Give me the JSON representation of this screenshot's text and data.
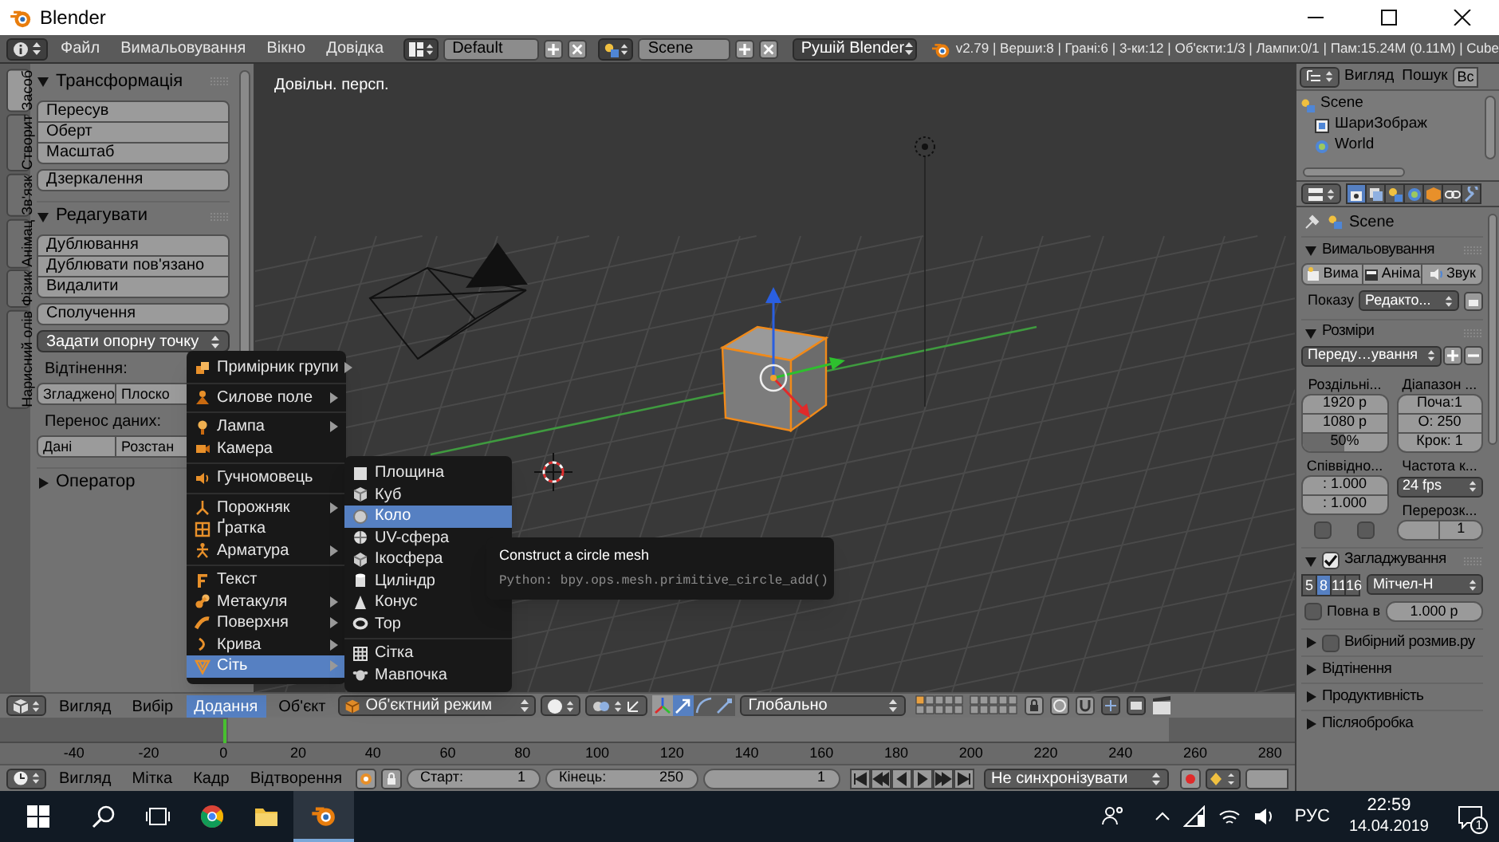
{
  "window": {
    "title": "Blender"
  },
  "info_header": {
    "menus": [
      "Файл",
      "Вимальовування",
      "Вікно",
      "Довідка"
    ],
    "layout": "Default",
    "scene": "Scene",
    "engine": "Рушій Blender",
    "stats": "v2.79 | Верши:8 | Грані:6 | 3-ки:12 | Об'єкти:1/3 | Лампи:0/1 | Пам:15.24M (0.11M) | Cube"
  },
  "tool_shelf": {
    "tabs": [
      {
        "label": "Засоб",
        "selected": true
      },
      {
        "label": "Створит",
        "selected": false
      },
      {
        "label": "Зв'язк",
        "selected": false
      },
      {
        "label": "Анімац",
        "selected": false
      },
      {
        "label": "Фізик",
        "selected": false
      },
      {
        "label": "Нарисний олів",
        "selected": false
      }
    ],
    "panels": [
      {
        "title": "Трансформація",
        "expanded": true,
        "rows": [
          {
            "kind": "stack",
            "buttons": [
              "Пересув",
              "Оберт",
              "Масштаб"
            ]
          },
          {
            "kind": "stack",
            "buttons": [
              "Дзеркалення"
            ]
          }
        ]
      },
      {
        "title": "Редагувати",
        "expanded": true,
        "rows": [
          {
            "kind": "stack",
            "buttons": [
              "Дублювання",
              "Дублювати пов'язано",
              "Видалити"
            ]
          },
          {
            "kind": "stack",
            "buttons": [
              "Сполучення"
            ]
          },
          {
            "kind": "dropdown",
            "value": "Задати опорну точку"
          },
          {
            "kind": "label",
            "text": "Відтінення:"
          },
          {
            "kind": "pair",
            "buttons": [
              "Згладжено",
              "Плоско"
            ]
          },
          {
            "kind": "label",
            "text": "Перенос даних:"
          },
          {
            "kind": "pair",
            "buttons": [
              "Дані",
              "Розстан"
            ]
          }
        ]
      },
      {
        "title": "Оператор",
        "expanded": false
      }
    ]
  },
  "viewport": {
    "label": "Довільн. персп."
  },
  "add_menu": {
    "groups": [
      [
        {
          "label": "Примірник групи",
          "submenu": true,
          "selected": false
        }
      ],
      [
        {
          "label": "Силове поле",
          "submenu": true,
          "selected": false
        }
      ],
      [
        {
          "label": "Лампа",
          "submenu": true,
          "selected": false
        },
        {
          "label": "Камера",
          "submenu": false,
          "selected": false
        }
      ],
      [
        {
          "label": "Гучномовець",
          "submenu": false,
          "selected": false
        }
      ],
      [
        {
          "label": "Порожняк",
          "submenu": true,
          "selected": false
        },
        {
          "label": "Ґратка",
          "submenu": false,
          "selected": false
        },
        {
          "label": "Арматура",
          "submenu": true,
          "selected": false
        }
      ],
      [
        {
          "label": "Текст",
          "submenu": false,
          "selected": false
        },
        {
          "label": "Метакуля",
          "submenu": true,
          "selected": false
        },
        {
          "label": "Поверхня",
          "submenu": true,
          "selected": false
        },
        {
          "label": "Крива",
          "submenu": true,
          "selected": false
        },
        {
          "label": "Сіть",
          "submenu": true,
          "selected": true
        }
      ]
    ]
  },
  "mesh_submenu": {
    "groups": [
      [
        {
          "label": "Площина",
          "selected": false
        },
        {
          "label": "Куб",
          "selected": false
        },
        {
          "label": "Коло",
          "selected": true
        },
        {
          "label": "UV-сфера",
          "selected": false
        },
        {
          "label": "Ікосфера",
          "selected": false
        },
        {
          "label": "Циліндр",
          "selected": false
        },
        {
          "label": "Конус",
          "selected": false
        },
        {
          "label": "Тор",
          "selected": false
        }
      ],
      [
        {
          "label": "Сітка",
          "selected": false
        },
        {
          "label": "Мавпочка",
          "selected": false
        }
      ]
    ]
  },
  "tooltip": {
    "title": "Construct a circle mesh",
    "python": "Python: bpy.ops.mesh.primitive_circle_add()"
  },
  "view3d_header": {
    "menus": [
      {
        "label": "Вигляд",
        "selected": false
      },
      {
        "label": "Вибір",
        "selected": false
      },
      {
        "label": "Додання",
        "selected": true
      },
      {
        "label": "Об'єкт",
        "selected": false
      }
    ],
    "mode": "Об'єктний режим",
    "orientation": "Глобально"
  },
  "timeline": {
    "ticks": [
      {
        "label": "-40",
        "current": false
      },
      {
        "label": "-20",
        "current": false
      },
      {
        "label": "0",
        "current": true
      },
      {
        "label": "20",
        "current": false
      },
      {
        "label": "40",
        "current": false
      },
      {
        "label": "60",
        "current": false
      },
      {
        "label": "80",
        "current": false
      },
      {
        "label": "100",
        "current": false
      },
      {
        "label": "120",
        "current": false
      },
      {
        "label": "140",
        "current": false
      },
      {
        "label": "160",
        "current": false
      },
      {
        "label": "180",
        "current": false
      },
      {
        "label": "200",
        "current": false
      },
      {
        "label": "220",
        "current": false
      },
      {
        "label": "240",
        "current": false
      },
      {
        "label": "260",
        "current": false
      },
      {
        "label": "280",
        "current": false
      }
    ]
  },
  "timeline_header": {
    "menus": [
      "Вигляд",
      "Мітка",
      "Кадр",
      "Відтворення"
    ],
    "start_label": "Старт:",
    "start": "1",
    "end_label": "Кінець:",
    "end": "250",
    "frame": "1",
    "sync": "Не синхронізувати"
  },
  "outliner": {
    "menus": [
      "Вигляд",
      "Пошук"
    ],
    "filter": "Вс",
    "tree": [
      {
        "label": "Scene",
        "children": [
          {
            "label": "ШариЗображ"
          },
          {
            "label": "World"
          }
        ]
      }
    ]
  },
  "properties": {
    "tabs": [
      {
        "selected": true
      },
      {
        "selected": false
      },
      {
        "selected": false
      },
      {
        "selected": false
      },
      {
        "selected": false
      },
      {
        "selected": false
      },
      {
        "selected": false
      }
    ],
    "breadcrumb": "Scene",
    "panels": [
      {
        "kind": "render",
        "title": "Вимальовування",
        "expanded": true,
        "buttons": [
          "Вима",
          "Аніма",
          "Звук"
        ],
        "display_label": "Показу",
        "display": "Редакто..."
      },
      {
        "kind": "dimensions",
        "title": "Розміри",
        "expanded": true,
        "preset": "Переду…ування",
        "resolution_label": "Роздільні...",
        "resolution_x": "1920 р",
        "resolution_y": "1080 р",
        "resolution_pct": {
          "text": "50%",
          "level": 0.5
        },
        "range_label": "Діапазон ...",
        "frame_start": "Поча:1",
        "frame_end": "О: 250",
        "frame_step": "Крок: 1",
        "aspect_label": "Співвідно...",
        "aspect_x": ": 1.000",
        "aspect_y": ": 1.000",
        "fps_label": "Частота к...",
        "fps": "24 fps",
        "border_checked": false,
        "crop_checked": false,
        "remap_label": "Перерозк...",
        "remap_new": "1"
      },
      {
        "kind": "antialiasing",
        "title": "Загладжування",
        "expanded": true,
        "checked": true,
        "samples": [
          {
            "label": "5",
            "selected": false
          },
          {
            "label": "8",
            "selected": true
          },
          {
            "label": "11",
            "selected": false
          },
          {
            "label": "16",
            "selected": false
          }
        ],
        "filter": "Мітчел-Н",
        "full_sample": {
          "label": "Повна в",
          "checked": false
        },
        "filter_size": "1.000 р"
      },
      {
        "kind": "plain",
        "title": "Вибірний розмив.ру",
        "expanded": false,
        "checked": false
      },
      {
        "kind": "plain",
        "title": "Відтінення",
        "expanded": false
      },
      {
        "kind": "plain",
        "title": "Продуктивність",
        "expanded": false
      },
      {
        "kind": "plain",
        "title": "Післяобробка",
        "expanded": false
      }
    ]
  },
  "taskbar": {
    "language": "РУС",
    "time": "22:59",
    "date": "14.04.2019",
    "notifications": "1"
  }
}
